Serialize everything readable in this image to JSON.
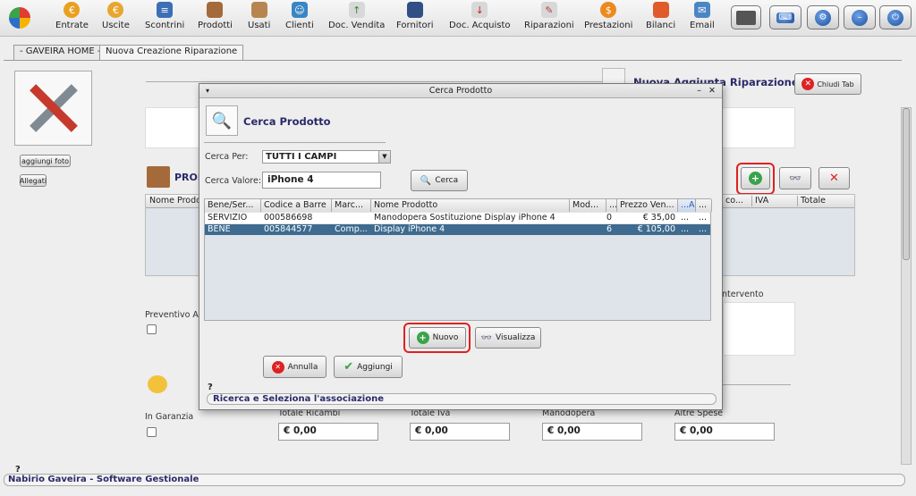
{
  "toolbar": {
    "items": [
      {
        "label": "Entrate",
        "icon": "coins-icon"
      },
      {
        "label": "Uscite",
        "icon": "coins-out-icon"
      },
      {
        "label": "Scontrini",
        "icon": "receipt-icon"
      },
      {
        "label": "Prodotti",
        "icon": "boxes-icon"
      },
      {
        "label": "Usati",
        "icon": "box-icon"
      },
      {
        "label": "Clienti",
        "icon": "client-icon"
      },
      {
        "label": "Doc. Vendita",
        "icon": "doc-sale-icon"
      },
      {
        "label": "Fornitori",
        "icon": "supplier-icon"
      },
      {
        "label": "Doc. Acquisto",
        "icon": "doc-purchase-icon"
      },
      {
        "label": "Riparazioni",
        "icon": "repair-icon"
      },
      {
        "label": "Prestazioni",
        "icon": "service-icon"
      },
      {
        "label": "Bilanci",
        "icon": "balance-icon"
      },
      {
        "label": "Email",
        "icon": "email-icon"
      }
    ]
  },
  "tabs": [
    "- GAVEIRA HOME -",
    "Nuova Creazione Riparazione"
  ],
  "main": {
    "header_title": "Nuova Aggiunta Riparazione",
    "close_tab": "Chiudi Tab",
    "add_photo": "aggiungi foto",
    "attachments": "Allegati",
    "products_title": "PROD",
    "col_nome_prodotto": "Nome Prodo",
    "col_co": "co...",
    "col_iva": "IVA",
    "col_totale": "Totale",
    "preventivo_label": "Preventivo Aut",
    "intervento_label": "ntervento",
    "in_garanzia": "In Garanzia",
    "totals": [
      {
        "label": "Totale Ricambi",
        "value": "€ 0,00"
      },
      {
        "label": "Totale Iva",
        "value": "€ 0,00"
      },
      {
        "label": "Manodopera",
        "value": "€ 0,00"
      },
      {
        "label": "Altre Spese",
        "value": "€ 0,00"
      }
    ],
    "status_q": "?",
    "status_text": "Nabirio Gaveira - Software Gestionale"
  },
  "dialog": {
    "title": "Cerca Prodotto",
    "heading": "Cerca Prodotto",
    "search_by_label": "Cerca Per:",
    "search_by_value": "TUTTI I CAMPI",
    "search_value_label": "Cerca Valore:",
    "search_value": "iPhone 4",
    "search_button": "Cerca",
    "columns": [
      "Bene/Ser...",
      "Codice a Barre",
      "Marc...",
      "Nome Prodotto",
      "Mod...",
      "...",
      "Prezzo Ven...",
      "...A",
      "..."
    ],
    "rows": [
      {
        "type": "SERVIZIO",
        "barcode": "000586698",
        "brand": "",
        "name": "Manodopera Sostituzione Display iPhone 4",
        "qty": "0",
        "price": "€ 35,00",
        "a": "...",
        "b": "..."
      },
      {
        "type": "BENE",
        "barcode": "005844577",
        "brand": "Comp...",
        "name": "Display iPhone 4",
        "qty": "6",
        "price": "€ 105,00",
        "a": "...",
        "b": "..."
      }
    ],
    "new_button": "Nuovo",
    "view_button": "Visualizza",
    "cancel_button": "Annulla",
    "add_button": "Aggiungi",
    "status_q": "?",
    "status_text": "Ricerca e Seleziona l'associazione"
  }
}
